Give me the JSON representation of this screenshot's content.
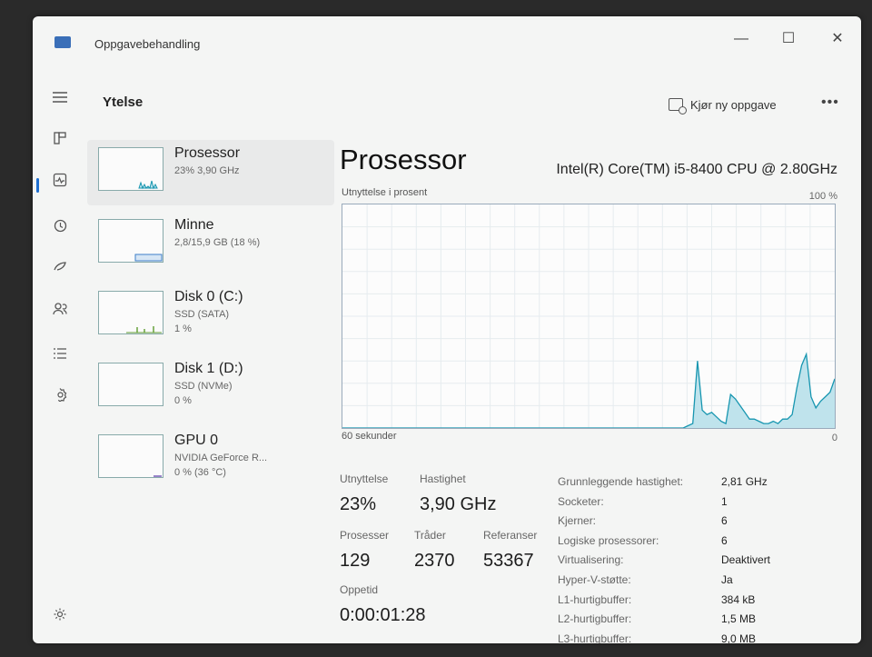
{
  "window": {
    "title": "Oppgavebehandling",
    "controls": {
      "minimize": "—",
      "maximize": "☐",
      "close": "✕"
    }
  },
  "header": {
    "title": "Ytelse",
    "run_task_label": "Kjør ny oppgave",
    "more_label": "•••"
  },
  "nav": {
    "icons": [
      "menu-icon",
      "processes-icon",
      "performance-icon",
      "app-history-icon",
      "startup-apps-icon",
      "users-icon",
      "details-icon",
      "services-icon",
      "settings-icon"
    ]
  },
  "devices": [
    {
      "name": "Prosessor",
      "sub1": "23% 3,90 GHz",
      "sub2": ""
    },
    {
      "name": "Minne",
      "sub1": "2,8/15,9 GB (18 %)",
      "sub2": ""
    },
    {
      "name": "Disk 0 (C:)",
      "sub1": "SSD (SATA)",
      "sub2": "1 %"
    },
    {
      "name": "Disk 1 (D:)",
      "sub1": "SSD (NVMe)",
      "sub2": "0 %"
    },
    {
      "name": "GPU 0",
      "sub1": "NVIDIA GeForce R...",
      "sub2": "0 % (36 °C)"
    }
  ],
  "cpu": {
    "title": "Prosessor",
    "model": "Intel(R) Core(TM) i5-8400 CPU @ 2.80GHz",
    "graph_label": "Utnyttelse i prosent",
    "graph_max": "100 %",
    "graph_x_left": "60 sekunder",
    "graph_x_right": "0",
    "history": [
      0,
      0,
      0,
      0,
      0,
      0,
      0,
      0,
      0,
      0,
      0,
      0,
      0,
      0,
      0,
      0,
      0,
      0,
      0,
      0,
      0,
      0,
      0,
      0,
      0,
      0,
      0,
      0,
      0,
      0,
      0,
      0,
      0,
      0,
      0,
      0,
      0,
      0,
      0,
      0,
      0,
      0,
      0,
      0,
      0,
      0,
      0,
      0,
      0,
      0,
      0,
      0,
      0,
      0,
      0,
      0,
      0,
      0,
      0,
      0,
      0,
      0,
      0,
      0,
      0,
      0,
      0,
      0,
      0,
      0,
      0,
      0,
      0,
      1,
      2,
      30,
      8,
      6,
      7,
      5,
      3,
      2,
      15,
      13,
      10,
      7,
      4,
      4,
      3,
      2,
      2,
      3,
      2,
      4,
      4,
      6,
      18,
      28,
      33,
      14,
      9,
      12,
      14,
      16,
      22
    ]
  },
  "stats": {
    "utilization_label": "Utnyttelse",
    "utilization": "23%",
    "speed_label": "Hastighet",
    "speed": "3,90 GHz",
    "processes_label": "Prosesser",
    "processes": "129",
    "threads_label": "Tråder",
    "threads": "2370",
    "handles_label": "Referanser",
    "handles": "53367",
    "uptime_label": "Oppetid",
    "uptime": "0:00:01:28"
  },
  "details": [
    {
      "key": "Grunnleggende hastighet:",
      "value": "2,81 GHz"
    },
    {
      "key": "Socketer:",
      "value": "1"
    },
    {
      "key": "Kjerner:",
      "value": "6"
    },
    {
      "key": "Logiske prosessorer:",
      "value": "6"
    },
    {
      "key": "Virtualisering:",
      "value": "Deaktivert"
    },
    {
      "key": "Hyper-V-støtte:",
      "value": "Ja"
    },
    {
      "key": "L1-hurtigbuffer:",
      "value": "384 kB"
    },
    {
      "key": "L2-hurtigbuffer:",
      "value": "1,5 MB"
    },
    {
      "key": "L3-hurtigbuffer:",
      "value": "9,0 MB"
    }
  ],
  "colors": {
    "cpu_line": "#1796b0",
    "cpu_fill": "#bfe3ec",
    "memory_line": "#3d7fc9",
    "disk_line": "#5d9b2f",
    "gpu_line": "#6b4fb3",
    "accent": "#1f6fd1"
  }
}
